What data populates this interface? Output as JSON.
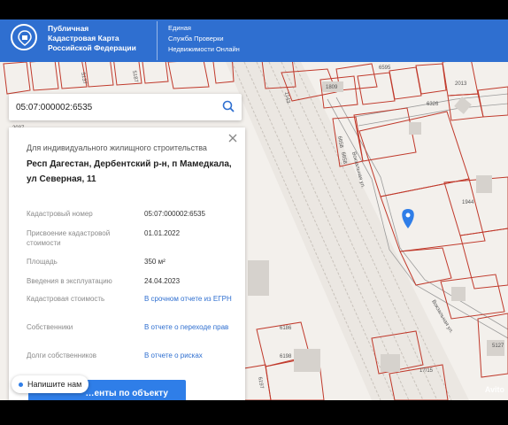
{
  "header": {
    "brand_lines": [
      "Публичная",
      "Кадастровая Карта",
      "Российской Федерации"
    ],
    "sub_lines": [
      "Единая",
      "Служба Проверки",
      "Недвижимости Онлайн"
    ]
  },
  "search": {
    "value": "05:07:000002:6535"
  },
  "card": {
    "purpose": "Для индивидуального жилищного строительства",
    "address": "Респ Дагестан, Дербентский р-н, п Мамедкала, ул Северная, 11",
    "rows": [
      {
        "label": "Кадастровый номер",
        "value": "05:07:000002:6535"
      },
      {
        "label": "Присвоение кадастровой стоимости",
        "value": "01.01.2022"
      },
      {
        "label": "Площадь",
        "value": "350 м²"
      },
      {
        "label": "Введения в эксплуатацию",
        "value": "24.04.2023"
      },
      {
        "label": "Кадастровая стоимость",
        "value": "В срочном отчете из ЕГРН"
      },
      {
        "label": "Собственники",
        "value": "В отчете о переходе прав"
      },
      {
        "label": "Долги собственников",
        "value": "В отчете о рисках"
      }
    ],
    "docs_button": "…енты по объекту"
  },
  "chat": {
    "label": "Напишите нам"
  },
  "watermark": "Avito",
  "map_labels": [
    "1809",
    "2013",
    "6326",
    "6595",
    "6658",
    "6658",
    "1944",
    "6198",
    "5127",
    "5137",
    "5187",
    "2037",
    "1143",
    "17/15",
    "6197",
    "6186",
    "Вокзальная ул.",
    "Вокзальная ул."
  ],
  "colors": {
    "brand": "#2f6fd0",
    "button": "#2f7ee8",
    "parcel": "#c0392b"
  }
}
